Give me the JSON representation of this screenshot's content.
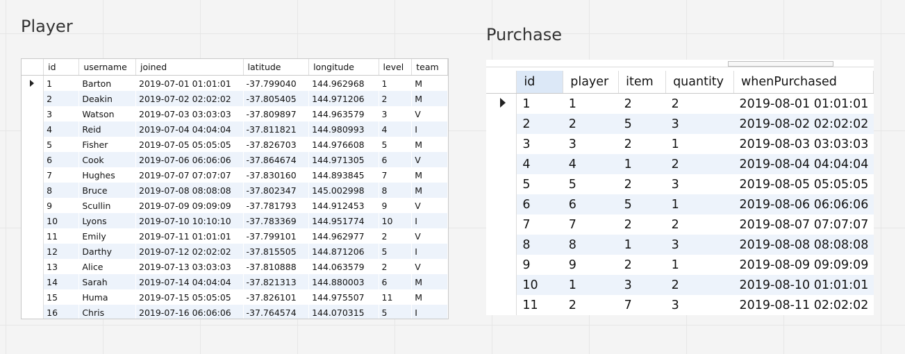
{
  "player": {
    "title": "Player",
    "columns": [
      "",
      "id",
      "username",
      "joined",
      "latitude",
      "longitude",
      "level",
      "team"
    ],
    "rows": [
      [
        "1",
        "Barton",
        "2019-07-01 01:01:01",
        "-37.799040",
        "144.962968",
        "1",
        "M"
      ],
      [
        "2",
        "Deakin",
        "2019-07-02 02:02:02",
        "-37.805405",
        "144.971206",
        "2",
        "M"
      ],
      [
        "3",
        "Watson",
        "2019-07-03 03:03:03",
        "-37.809897",
        "144.963579",
        "3",
        "V"
      ],
      [
        "4",
        "Reid",
        "2019-07-04 04:04:04",
        "-37.811821",
        "144.980993",
        "4",
        "I"
      ],
      [
        "5",
        "Fisher",
        "2019-07-05 05:05:05",
        "-37.826703",
        "144.976608",
        "5",
        "M"
      ],
      [
        "6",
        "Cook",
        "2019-07-06 06:06:06",
        "-37.864674",
        "144.971305",
        "6",
        "V"
      ],
      [
        "7",
        "Hughes",
        "2019-07-07 07:07:07",
        "-37.830160",
        "144.893845",
        "7",
        "M"
      ],
      [
        "8",
        "Bruce",
        "2019-07-08 08:08:08",
        "-37.802347",
        "145.002998",
        "8",
        "M"
      ],
      [
        "9",
        "Scullin",
        "2019-07-09 09:09:09",
        "-37.781793",
        "144.912453",
        "9",
        "V"
      ],
      [
        "10",
        "Lyons",
        "2019-07-10 10:10:10",
        "-37.783369",
        "144.951774",
        "10",
        "I"
      ],
      [
        "11",
        "Emily",
        "2019-07-11 01:01:01",
        "-37.799101",
        "144.962977",
        "2",
        "V"
      ],
      [
        "12",
        "Darthy",
        "2019-07-12 02:02:02",
        "-37.815505",
        "144.871206",
        "5",
        "I"
      ],
      [
        "13",
        "Alice",
        "2019-07-13 03:03:03",
        "-37.810888",
        "144.063579",
        "2",
        "V"
      ],
      [
        "14",
        "Sarah",
        "2019-07-14 04:04:04",
        "-37.821313",
        "144.880003",
        "6",
        "M"
      ],
      [
        "15",
        "Huma",
        "2019-07-15 05:05:05",
        "-37.826101",
        "144.975507",
        "11",
        "M"
      ],
      [
        "16",
        "Chris",
        "2019-07-16 06:06:06",
        "-37.764574",
        "144.070315",
        "5",
        "I"
      ]
    ]
  },
  "purchase": {
    "title": "Purchase",
    "columns": [
      "",
      "id",
      "player",
      "item",
      "quantity",
      "whenPurchased"
    ],
    "rows": [
      [
        "1",
        "1",
        "2",
        "2",
        "2019-08-01 01:01:01"
      ],
      [
        "2",
        "2",
        "5",
        "3",
        "2019-08-02 02:02:02"
      ],
      [
        "3",
        "3",
        "2",
        "1",
        "2019-08-03 03:03:03"
      ],
      [
        "4",
        "4",
        "1",
        "2",
        "2019-08-04 04:04:04"
      ],
      [
        "5",
        "5",
        "2",
        "3",
        "2019-08-05 05:05:05"
      ],
      [
        "6",
        "6",
        "5",
        "1",
        "2019-08-06 06:06:06"
      ],
      [
        "7",
        "7",
        "2",
        "2",
        "2019-08-07 07:07:07"
      ],
      [
        "8",
        "8",
        "1",
        "3",
        "2019-08-08 08:08:08"
      ],
      [
        "9",
        "9",
        "2",
        "1",
        "2019-08-09 09:09:09"
      ],
      [
        "10",
        "1",
        "3",
        "2",
        "2019-08-10 01:01:01"
      ],
      [
        "11",
        "2",
        "7",
        "3",
        "2019-08-11 02:02:02"
      ]
    ]
  },
  "icons": {
    "current_row": "row-pointer-icon"
  }
}
